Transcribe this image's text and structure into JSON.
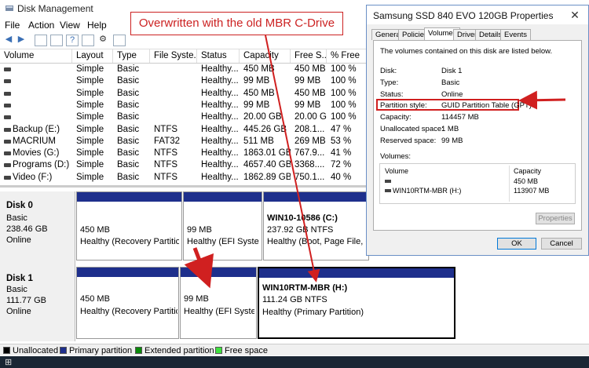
{
  "window": {
    "title": "Disk Management"
  },
  "menu": [
    "File",
    "Action",
    "View",
    "Help"
  ],
  "columns": [
    "Volume",
    "Layout",
    "Type",
    "File Syste...",
    "Status",
    "Capacity",
    "Free S...",
    "% Free"
  ],
  "volumes": [
    {
      "volume": "",
      "layout": "Simple",
      "type": "Basic",
      "fs": "",
      "status": "Healthy...",
      "capacity": "450 MB",
      "free": "450 MB",
      "pct": "100 %"
    },
    {
      "volume": "",
      "layout": "Simple",
      "type": "Basic",
      "fs": "",
      "status": "Healthy...",
      "capacity": "99 MB",
      "free": "99 MB",
      "pct": "100 %"
    },
    {
      "volume": "",
      "layout": "Simple",
      "type": "Basic",
      "fs": "",
      "status": "Healthy...",
      "capacity": "450 MB",
      "free": "450 MB",
      "pct": "100 %"
    },
    {
      "volume": "",
      "layout": "Simple",
      "type": "Basic",
      "fs": "",
      "status": "Healthy...",
      "capacity": "99 MB",
      "free": "99 MB",
      "pct": "100 %"
    },
    {
      "volume": "",
      "layout": "Simple",
      "type": "Basic",
      "fs": "",
      "status": "Healthy...",
      "capacity": "20.00 GB",
      "free": "20.00 GB",
      "pct": "100 %"
    },
    {
      "volume": "Backup (E:)",
      "layout": "Simple",
      "type": "Basic",
      "fs": "NTFS",
      "status": "Healthy...",
      "capacity": "445.26 GB",
      "free": "208.1...",
      "pct": "47 %"
    },
    {
      "volume": "MACRIUM",
      "layout": "Simple",
      "type": "Basic",
      "fs": "FAT32",
      "status": "Healthy...",
      "capacity": "511 MB",
      "free": "269 MB",
      "pct": "53 %"
    },
    {
      "volume": "Movies (G:)",
      "layout": "Simple",
      "type": "Basic",
      "fs": "NTFS",
      "status": "Healthy...",
      "capacity": "1863.01 GB",
      "free": "767.9...",
      "pct": "41 %"
    },
    {
      "volume": "Programs (D:)",
      "layout": "Simple",
      "type": "Basic",
      "fs": "NTFS",
      "status": "Healthy...",
      "capacity": "4657.40 GB",
      "free": "3368....",
      "pct": "72 %"
    },
    {
      "volume": "Video (F:)",
      "layout": "Simple",
      "type": "Basic",
      "fs": "NTFS",
      "status": "Healthy...",
      "capacity": "1862.89 GB",
      "free": "750.1...",
      "pct": "40 %"
    }
  ],
  "disks": [
    {
      "name": "Disk 0",
      "type": "Basic",
      "size": "238.46 GB",
      "state": "Online",
      "partitions": [
        {
          "title": "",
          "size": "450 MB",
          "status": "Healthy (Recovery Partitio"
        },
        {
          "title": "",
          "size": "99 MB",
          "status": "Healthy (EFI Systen"
        },
        {
          "title": "WIN10-10586  (C:)",
          "size": "237.92 GB NTFS",
          "status": "Healthy (Boot, Page File, Cr"
        }
      ]
    },
    {
      "name": "Disk 1",
      "type": "Basic",
      "size": "111.77 GB",
      "state": "Online",
      "partitions": [
        {
          "title": "",
          "size": "450 MB",
          "status": "Healthy (Recovery Partitio"
        },
        {
          "title": "",
          "size": "99 MB",
          "status": "Healthy (EFI Syster"
        },
        {
          "title": "WIN10RTM-MBR  (H:)",
          "size": "111.24 GB NTFS",
          "status": "Healthy (Primary Partition)"
        }
      ]
    }
  ],
  "legend": [
    {
      "label": "Unallocated",
      "color": "#000000"
    },
    {
      "label": "Primary partition",
      "color": "#1e2f8c"
    },
    {
      "label": "Extended partition",
      "color": "#0a8a0a"
    },
    {
      "label": "Free space",
      "color": "#3ee03e"
    }
  ],
  "annotation": {
    "text": "Overwritten with the old MBR C-Drive",
    "color": "#d02020"
  },
  "dialog": {
    "title": "Samsung SSD 840 EVO 120GB Properties",
    "tabs": [
      "General",
      "Policies",
      "Volumes",
      "Driver",
      "Details",
      "Events"
    ],
    "active_tab": "Volumes",
    "intro": "The volumes contained on this disk are listed below.",
    "props": [
      {
        "key": "Disk:",
        "value": "Disk 1"
      },
      {
        "key": "Type:",
        "value": "Basic"
      },
      {
        "key": "Status:",
        "value": "Online"
      },
      {
        "key": "Partition style:",
        "value": "GUID Partition Table (GPT)"
      },
      {
        "key": "Capacity:",
        "value": "114457 MB"
      },
      {
        "key": "Unallocated space:",
        "value": "1 MB"
      },
      {
        "key": "Reserved space:",
        "value": "99 MB"
      }
    ],
    "volumes_label": "Volumes:",
    "vol_columns": [
      "Volume",
      "Capacity"
    ],
    "vol_rows": [
      {
        "volume": "",
        "capacity": "450 MB"
      },
      {
        "volume": "WIN10RTM-MBR (H:)",
        "capacity": "113907 MB"
      }
    ],
    "properties_btn": "Properties",
    "ok": "OK",
    "cancel": "Cancel"
  }
}
